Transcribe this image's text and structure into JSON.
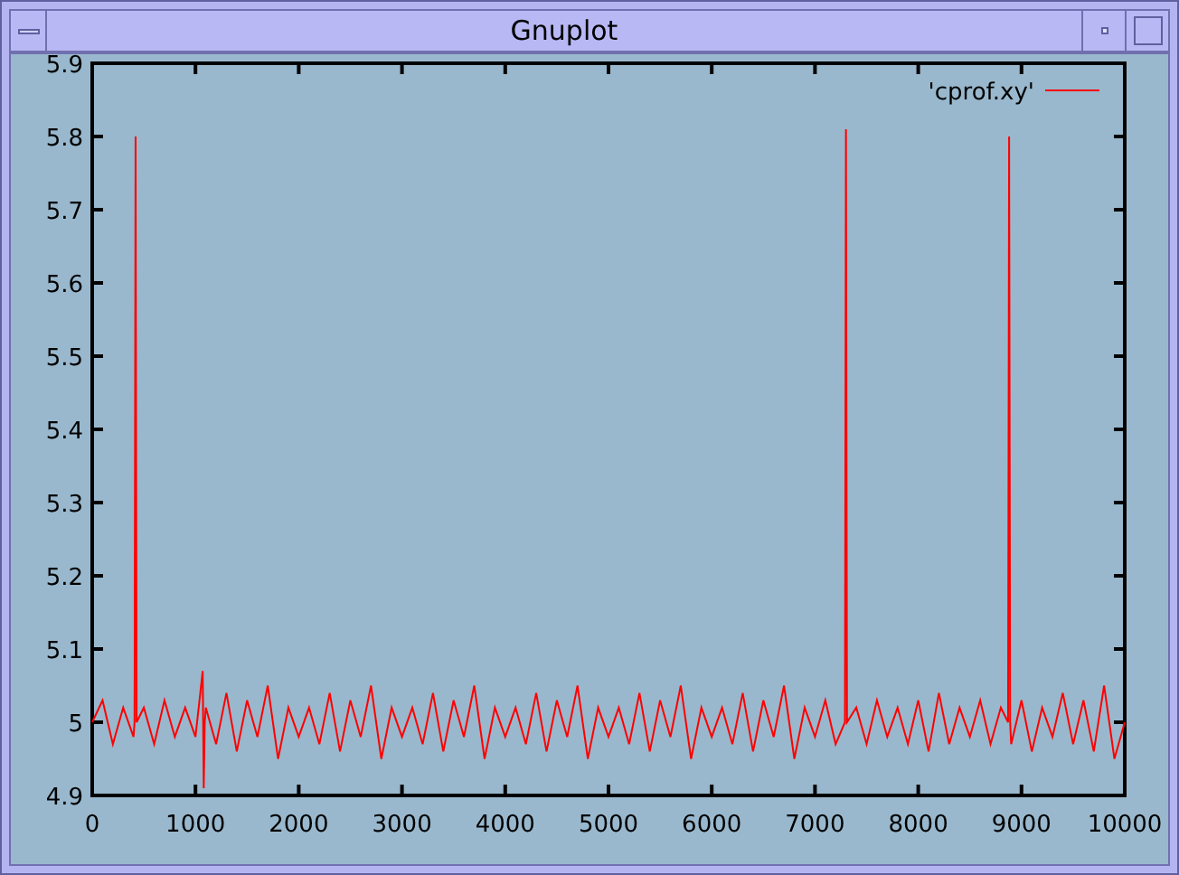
{
  "window": {
    "title": "Gnuplot"
  },
  "plot": {
    "chart_data": {
      "type": "line",
      "xlim": [
        0,
        10000
      ],
      "ylim": [
        4.9,
        5.9
      ],
      "xticks": [
        0,
        1000,
        2000,
        3000,
        4000,
        5000,
        6000,
        7000,
        8000,
        9000,
        10000
      ],
      "yticks": [
        4.9,
        5,
        5.1,
        5.2,
        5.3,
        5.4,
        5.5,
        5.6,
        5.7,
        5.8,
        5.9
      ],
      "x": [
        0,
        100,
        200,
        300,
        400,
        410,
        420,
        430,
        500,
        600,
        700,
        800,
        900,
        1000,
        1070,
        1080,
        1090,
        1100,
        1200,
        1300,
        1400,
        1500,
        1600,
        1700,
        1800,
        1900,
        2000,
        2100,
        2200,
        2300,
        2400,
        2500,
        2600,
        2700,
        2800,
        2900,
        3000,
        3100,
        3200,
        3300,
        3400,
        3500,
        3600,
        3700,
        3800,
        3900,
        4000,
        4100,
        4200,
        4300,
        4400,
        4500,
        4600,
        4700,
        4800,
        4900,
        5000,
        5100,
        5200,
        5300,
        5400,
        5500,
        5600,
        5700,
        5800,
        5900,
        6000,
        6100,
        6200,
        6300,
        6400,
        6500,
        6600,
        6700,
        6800,
        6900,
        7000,
        7100,
        7200,
        7290,
        7300,
        7310,
        7400,
        7500,
        7600,
        7700,
        7800,
        7900,
        8000,
        8100,
        8200,
        8300,
        8400,
        8500,
        8600,
        8700,
        8800,
        8870,
        8880,
        8890,
        8900,
        9000,
        9100,
        9200,
        9300,
        9400,
        9500,
        9600,
        9700,
        9800,
        9900,
        10000
      ],
      "series": [
        {
          "name": "'cprof.xy'",
          "color": "#ff0000",
          "values": [
            5,
            5.03,
            4.97,
            5.02,
            4.98,
            5,
            5.8,
            5,
            5.02,
            4.97,
            5.03,
            4.98,
            5.02,
            4.98,
            5.07,
            4.91,
            5,
            5.02,
            4.97,
            5.04,
            4.96,
            5.03,
            4.98,
            5.05,
            4.95,
            5.02,
            4.98,
            5.02,
            4.97,
            5.04,
            4.96,
            5.03,
            4.98,
            5.05,
            4.95,
            5.02,
            4.98,
            5.02,
            4.97,
            5.04,
            4.96,
            5.03,
            4.98,
            5.05,
            4.95,
            5.02,
            4.98,
            5.02,
            4.97,
            5.04,
            4.96,
            5.03,
            4.98,
            5.05,
            4.95,
            5.02,
            4.98,
            5.02,
            4.97,
            5.04,
            4.96,
            5.03,
            4.98,
            5.05,
            4.95,
            5.02,
            4.98,
            5.02,
            4.97,
            5.04,
            4.96,
            5.03,
            4.98,
            5.05,
            4.95,
            5.02,
            4.98,
            5.03,
            4.97,
            5,
            5.81,
            5,
            5.02,
            4.97,
            5.03,
            4.98,
            5.02,
            4.97,
            5.03,
            4.96,
            5.04,
            4.97,
            5.02,
            4.98,
            5.03,
            4.97,
            5.02,
            5,
            5.8,
            5,
            4.97,
            5.03,
            4.96,
            5.02,
            4.98,
            5.04,
            4.97,
            5.03,
            4.96,
            5.05,
            4.95,
            5
          ]
        }
      ]
    }
  }
}
